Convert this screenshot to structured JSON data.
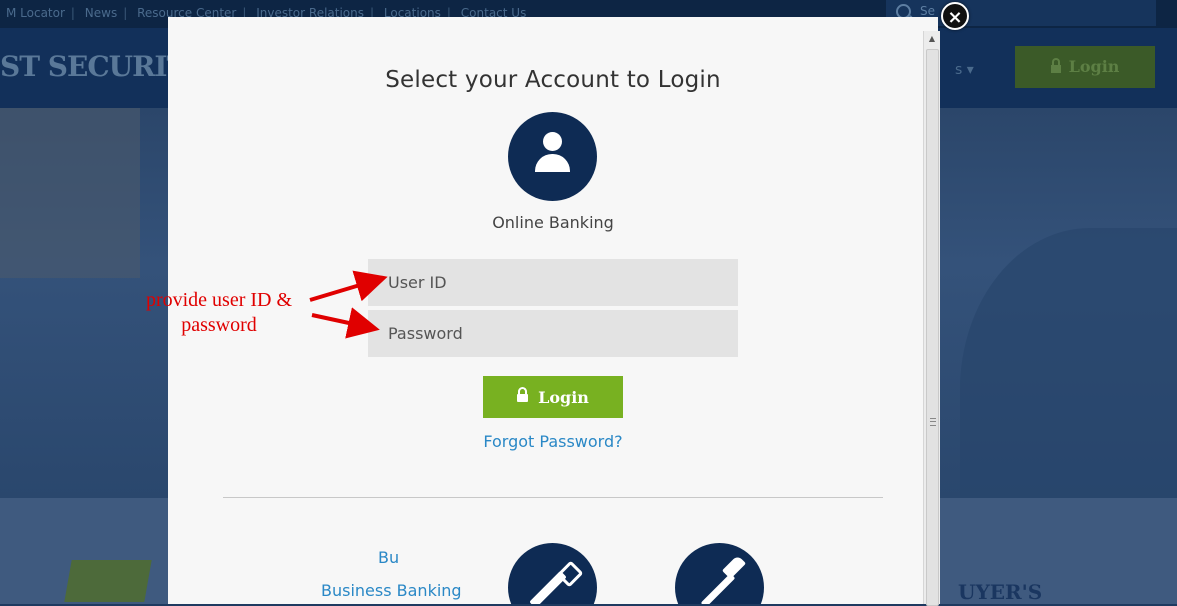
{
  "background": {
    "top_links": [
      "M Locator",
      "News",
      "Resource Center",
      "Investor Relations",
      "Locations",
      "Contact Us"
    ],
    "search_placeholder": "Se",
    "logo_text": "ST SECURIT",
    "nav_login_label": "Login",
    "banner_fragment": "UYER'S"
  },
  "modal": {
    "title": "Select your Account to Login",
    "account_label": "Online Banking",
    "user_id_placeholder": "User ID",
    "password_placeholder": "Password",
    "login_label": "Login",
    "forgot_label": "Forgot Password?",
    "close_label": "×",
    "business_cut_label": "Bu",
    "business_label": "Business Banking"
  },
  "annotation": {
    "line1": "provide user ID &",
    "line2": "password",
    "color": "#e00000"
  },
  "colors": {
    "navy": "#0e2b54",
    "green": "#78b121",
    "link": "#2a88c6"
  },
  "icons": [
    "user-icon",
    "lock-icon",
    "saw-icon",
    "hammer-icon",
    "close-icon"
  ]
}
